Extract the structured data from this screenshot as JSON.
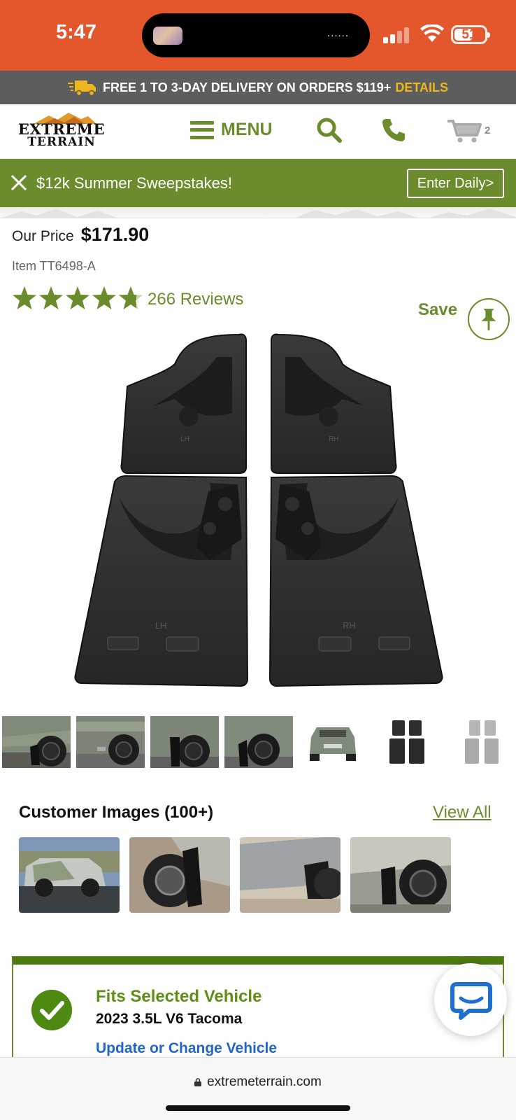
{
  "status_bar": {
    "time": "5:47",
    "island_dots": "......",
    "battery": "51",
    "icons": [
      "signal-icon",
      "wifi-icon",
      "battery-icon"
    ]
  },
  "delivery_banner": {
    "text": "FREE 1 TO 3-DAY DELIVERY ON ORDERS $119+",
    "link": "DETAILS"
  },
  "header": {
    "logo_line1": "EXTREME",
    "logo_line2": "TERRAIN",
    "menu_label": "MENU",
    "cart_count": "2",
    "icons": [
      "menu-icon",
      "search-icon",
      "phone-icon",
      "cart-icon"
    ]
  },
  "promo": {
    "text": "$12k Summer Sweepstakes!",
    "button": "Enter Daily>"
  },
  "product": {
    "price_label": "Our Price",
    "price": "$171.90",
    "item_number": "Item TT6498-A",
    "rating": 4.8,
    "reviews": "266 Reviews",
    "save_label": "Save"
  },
  "hero_image": {
    "panel_labels": [
      "LH",
      "RH"
    ]
  },
  "thumbnails": [
    {
      "name": "thumb-rear-wheel-1"
    },
    {
      "name": "thumb-rear-wheel-2"
    },
    {
      "name": "thumb-front-wheel-1"
    },
    {
      "name": "thumb-front-wheel-2"
    },
    {
      "name": "thumb-truck-rear"
    },
    {
      "name": "thumb-flaps-black"
    },
    {
      "name": "thumb-flaps-grey"
    }
  ],
  "customer_images": {
    "title": "Customer Images (100+)",
    "view_all": "View All"
  },
  "fitment": {
    "title": "Fits Selected Vehicle",
    "vehicle": "2023 3.5L V6 Tacoma",
    "change_link": "Update or Change Vehicle"
  },
  "browser": {
    "url": "extremeterrain.com"
  },
  "colors": {
    "status_orange": "#e4562b",
    "brand_green": "#6b8c2c",
    "delivery_gray": "#5c5d5e",
    "link_yellow": "#f0b41c",
    "link_blue": "#1f66c8"
  }
}
